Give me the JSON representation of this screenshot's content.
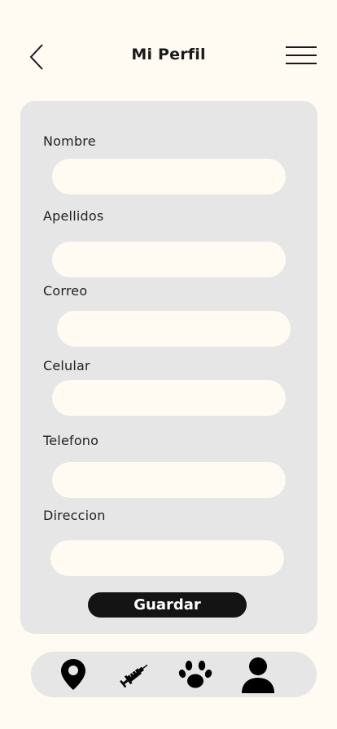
{
  "header": {
    "title": "Mi Perfil",
    "back_icon": "chevron-left-icon",
    "menu_icon": "hamburger-menu-icon"
  },
  "form": {
    "fields": [
      {
        "label": "Nombre",
        "value": "",
        "placeholder": ""
      },
      {
        "label": "Apellidos",
        "value": "",
        "placeholder": ""
      },
      {
        "label": "Correo",
        "value": "",
        "placeholder": ""
      },
      {
        "label": "Celular",
        "value": "",
        "placeholder": ""
      },
      {
        "label": "Telefono",
        "value": "",
        "placeholder": ""
      },
      {
        "label": "Direccion",
        "value": "",
        "placeholder": ""
      }
    ],
    "save_label": "Guardar"
  },
  "bottom_nav": {
    "items": [
      {
        "icon": "location-pin-icon"
      },
      {
        "icon": "syringe-icon"
      },
      {
        "icon": "paw-icon"
      },
      {
        "icon": "user-icon"
      }
    ]
  },
  "colors": {
    "background": "#FFFAF2",
    "card": "#E6E6E6",
    "button": "#141414"
  }
}
